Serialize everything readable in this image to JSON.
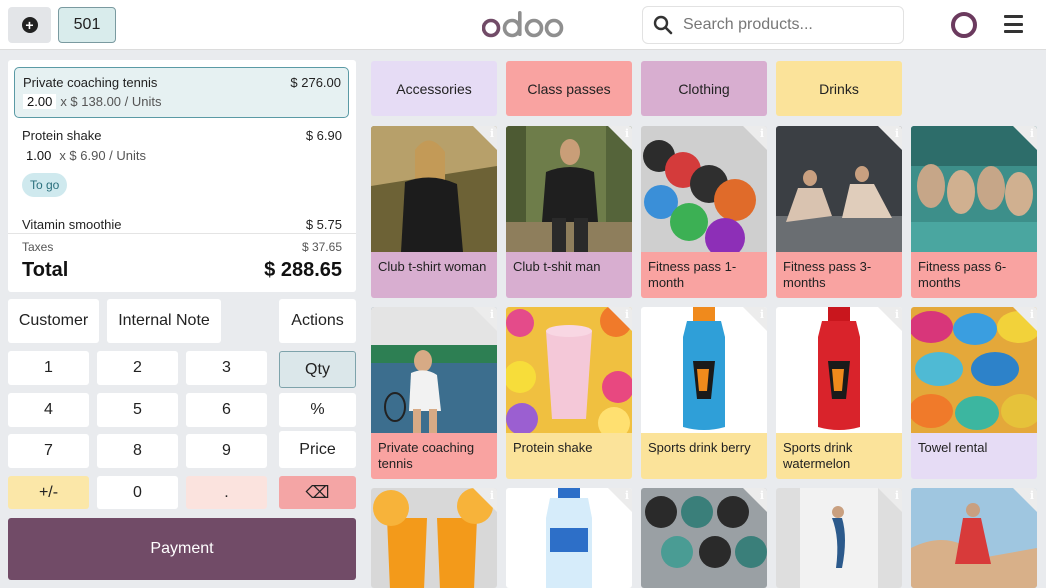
{
  "header": {
    "order_number": "501",
    "logo_text": "odoo",
    "search_placeholder": "Search products...",
    "colors": {
      "brand": "#714b67",
      "brand_logo": "#8f8f8f"
    }
  },
  "order": {
    "lines": [
      {
        "name": "Private coaching tennis",
        "price": "$ 276.00",
        "qty": "2.00",
        "unit_price": "x $ 138.00 / Units",
        "selected": true
      },
      {
        "name": "Protein shake",
        "price": "$ 6.90",
        "qty": "1.00",
        "unit_price": "x $ 6.90 / Units",
        "badge": "To go"
      },
      {
        "name": "Vitamin smoothie",
        "price": "$ 5.75"
      }
    ],
    "taxes_label": "Taxes",
    "taxes_value": "$ 37.65",
    "total_label": "Total",
    "total_value": "$ 288.65"
  },
  "actions": {
    "customer": "Customer",
    "internal_note": "Internal Note",
    "actions": "Actions"
  },
  "numpad": {
    "keys": [
      "1",
      "2",
      "3",
      "Qty",
      "4",
      "5",
      "6",
      "%",
      "7",
      "8",
      "9",
      "Price",
      "+/-",
      "0",
      ".",
      "⌫"
    ],
    "backspace_icon": "backspace-icon"
  },
  "payment_label": "Payment",
  "categories": [
    {
      "label": "Accessories",
      "color": "#e6dcf5"
    },
    {
      "label": "Class passes",
      "color": "#f9a3a1"
    },
    {
      "label": "Clothing",
      "color": "#d8aed0"
    },
    {
      "label": "Drinks",
      "color": "#fbe39a"
    }
  ],
  "products": [
    {
      "name": "Club t-shirt woman",
      "color": "#d8aed0"
    },
    {
      "name": "Club t-shit man",
      "color": "#d8aed0"
    },
    {
      "name": "Fitness pass 1-month",
      "color": "#f9a3a1"
    },
    {
      "name": "Fitness pass 3-months",
      "color": "#f9a3a1"
    },
    {
      "name": "Fitness pass 6-months",
      "color": "#f9a3a1"
    },
    {
      "name": "Private coaching tennis",
      "color": "#f9a3a1"
    },
    {
      "name": "Protein shake",
      "color": "#fbe39a"
    },
    {
      "name": "Sports drink berry",
      "color": "#fbe39a"
    },
    {
      "name": "Sports drink watermelon",
      "color": "#fbe39a"
    },
    {
      "name": "Towel rental",
      "color": "#e6dcf5"
    }
  ],
  "info_icon": "info-icon"
}
